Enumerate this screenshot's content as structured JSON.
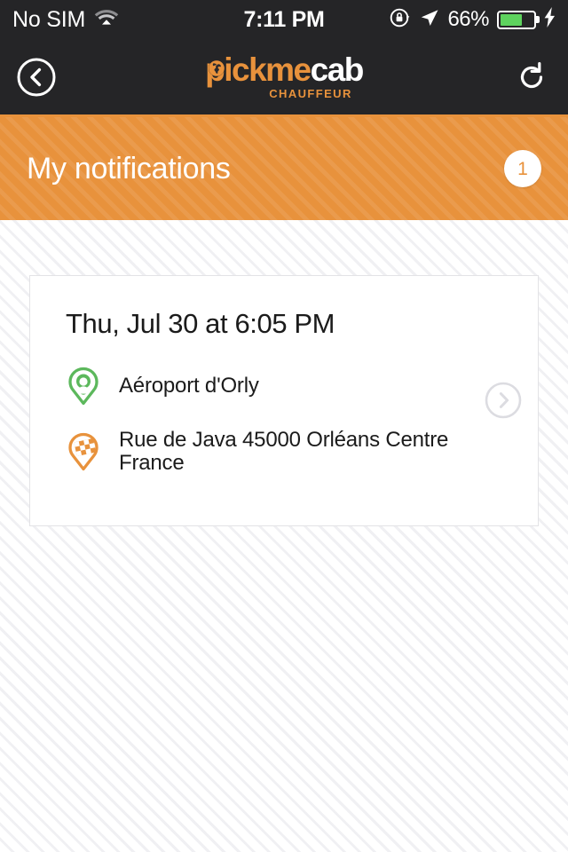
{
  "status_bar": {
    "carrier": "No SIM",
    "wifi_icon": "wifi-icon",
    "time": "7:11 PM",
    "rotation_lock_icon": "rotation-lock-icon",
    "location_icon": "location-arrow-icon",
    "battery_percent": "66%",
    "battery_level": 66,
    "charging_icon": "lightning-bolt-icon",
    "battery_color": "#5ed35e"
  },
  "nav_bar": {
    "back_icon": "chevron-left-circle-icon",
    "refresh_icon": "refresh-icon",
    "brand": {
      "part_orange": "pickme",
      "part_white": "cab",
      "tagline": "CHAUFFEUR",
      "globe_icon": "globe-icon"
    },
    "accent_color": "#e8923c",
    "background_color": "#252527"
  },
  "section": {
    "title": "My notifications",
    "badge_count": "1",
    "background_color": "#e8923c"
  },
  "notification": {
    "date": "Thu, Jul 30 at 6:05 PM",
    "pickup": {
      "icon": "pin-person-icon",
      "icon_color": "#5cb85c",
      "address": "Aéroport d'Orly"
    },
    "dropoff": {
      "icon": "pin-flag-icon",
      "icon_color": "#e8923c",
      "address": "Rue de Java 45000 Orléans Centre France"
    },
    "open_icon": "chevron-right-circle-icon"
  }
}
